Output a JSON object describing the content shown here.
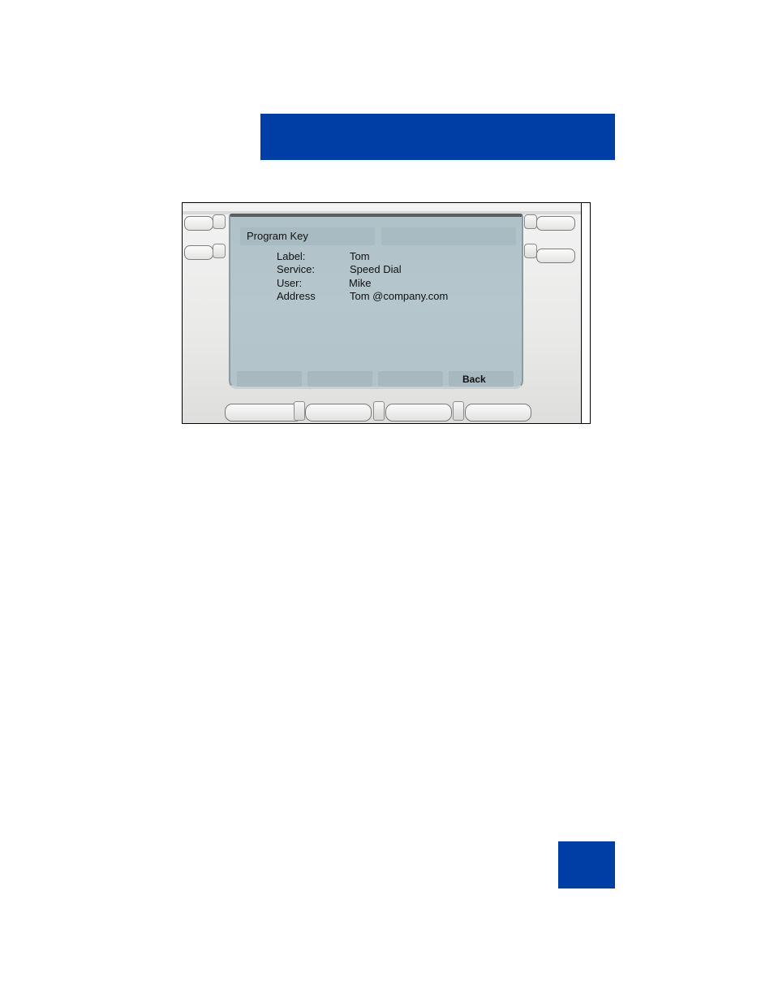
{
  "header": {
    "accent_color": "#003da5"
  },
  "phone": {
    "screen": {
      "title": "Program Key",
      "details": [
        {
          "label": "Label:",
          "value": "Tom"
        },
        {
          "label": "Service:",
          "value": "Speed Dial"
        },
        {
          "label": "User:",
          "value": "Mike"
        },
        {
          "label": "Address",
          "value": "Tom @company.com"
        }
      ],
      "softkeys": [
        "",
        "",
        "",
        "Back"
      ]
    }
  },
  "page_tab": {
    "accent_color": "#003da5"
  }
}
